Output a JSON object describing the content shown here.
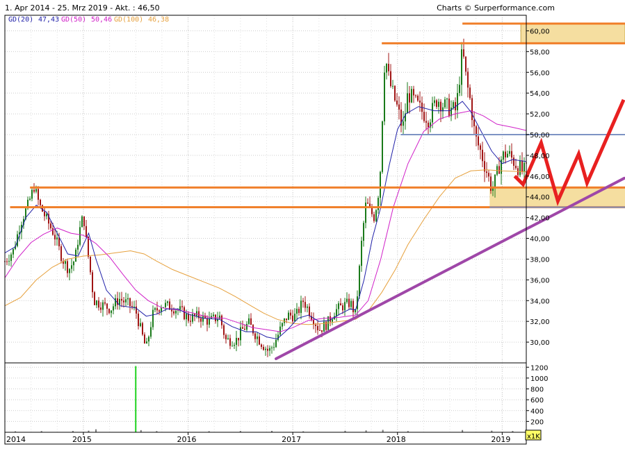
{
  "header": {
    "range_text": "1. Apr 2014 - 25. Mrz 2019 - Akt. : 46,50",
    "credit_text": "Charts © Surperformance.com"
  },
  "chart_data": {
    "type": "candlestick",
    "legend": [
      {
        "text": "GD(20)",
        "value": "47,43",
        "color": "#1f1fa8"
      },
      {
        "text": "GD(50)",
        "value": "50,46",
        "color": "#d020c8"
      },
      {
        "text": "GD(100)",
        "value": "46,38",
        "color": "#e6a03c"
      }
    ],
    "y_axis": {
      "ylim": [
        28.0,
        61.5
      ],
      "ticks": [
        30,
        32,
        34,
        36,
        38,
        40,
        42,
        44,
        46,
        48,
        50,
        52,
        54,
        56,
        58,
        60
      ],
      "tick_labels": [
        "30,00",
        "32,00",
        "34,00",
        "36,00",
        "38,00",
        "40,00",
        "42,00",
        "44,00",
        "46,00",
        "48,00",
        "50,00",
        "52,00",
        "54,00",
        "56,00",
        "58,00",
        "60,00"
      ]
    },
    "volume_axis": {
      "ylim": [
        0,
        1280
      ],
      "ticks": [
        200,
        400,
        600,
        800,
        1000,
        1200
      ],
      "tick_labels": [
        "200",
        "400",
        "600",
        "800",
        "1000",
        "1200"
      ],
      "unit": "x1K"
    },
    "x_axis": {
      "range": [
        2014.25,
        2019.23
      ],
      "ticks": [
        2014,
        2015,
        2016,
        2017,
        2018,
        2019
      ],
      "tick_labels": [
        "2014",
        "2015",
        "2016",
        "2017",
        "2018",
        "2019"
      ]
    },
    "price_path": [
      [
        2014.25,
        37.8
      ],
      [
        2014.33,
        38.8
      ],
      [
        2014.4,
        41.5
      ],
      [
        2014.47,
        43.2
      ],
      [
        2014.53,
        45.0
      ],
      [
        2014.58,
        43.2
      ],
      [
        2014.66,
        41.6
      ],
      [
        2014.72,
        40.4
      ],
      [
        2014.8,
        38.0
      ],
      [
        2014.86,
        37.0
      ],
      [
        2014.92,
        38.0
      ],
      [
        2014.96,
        40.6
      ],
      [
        2015.0,
        42.3
      ],
      [
        2015.03,
        39.5
      ],
      [
        2015.07,
        36.5
      ],
      [
        2015.1,
        34.0
      ],
      [
        2015.18,
        33.6
      ],
      [
        2015.26,
        33.2
      ],
      [
        2015.34,
        34.2
      ],
      [
        2015.44,
        33.6
      ],
      [
        2015.5,
        33.0
      ],
      [
        2015.56,
        30.7
      ],
      [
        2015.6,
        29.3
      ],
      [
        2015.66,
        32.6
      ],
      [
        2015.74,
        33.6
      ],
      [
        2015.84,
        33.4
      ],
      [
        2015.93,
        33.0
      ],
      [
        2016.0,
        32.3
      ],
      [
        2016.1,
        32.5
      ],
      [
        2016.2,
        32.0
      ],
      [
        2016.3,
        32.5
      ],
      [
        2016.36,
        30.2
      ],
      [
        2016.46,
        30.2
      ],
      [
        2016.52,
        31.2
      ],
      [
        2016.58,
        31.8
      ],
      [
        2016.64,
        30.8
      ],
      [
        2016.71,
        29.8
      ],
      [
        2016.77,
        29.1
      ],
      [
        2016.82,
        29.8
      ],
      [
        2016.88,
        31.2
      ],
      [
        2016.95,
        32.6
      ],
      [
        2017.03,
        32.5
      ],
      [
        2017.1,
        34.0
      ],
      [
        2017.18,
        32.6
      ],
      [
        2017.25,
        31.2
      ],
      [
        2017.33,
        31.8
      ],
      [
        2017.4,
        33.0
      ],
      [
        2017.48,
        33.5
      ],
      [
        2017.55,
        33.8
      ],
      [
        2017.6,
        32.6
      ],
      [
        2017.64,
        37.5
      ],
      [
        2017.66,
        40.0
      ],
      [
        2017.7,
        43.5
      ],
      [
        2017.74,
        42.6
      ],
      [
        2017.78,
        42.0
      ],
      [
        2017.83,
        45.2
      ],
      [
        2017.85,
        50.5
      ],
      [
        2017.88,
        57.8
      ],
      [
        2017.92,
        55.2
      ],
      [
        2017.96,
        53.8
      ],
      [
        2018.0,
        52.5
      ],
      [
        2018.05,
        50.5
      ],
      [
        2018.1,
        54.0
      ],
      [
        2018.16,
        53.2
      ],
      [
        2018.22,
        52.4
      ],
      [
        2018.3,
        51.5
      ],
      [
        2018.38,
        53.5
      ],
      [
        2018.44,
        52.8
      ],
      [
        2018.5,
        52.5
      ],
      [
        2018.56,
        52.3
      ],
      [
        2018.62,
        58.2
      ],
      [
        2018.66,
        55.0
      ],
      [
        2018.7,
        53.0
      ],
      [
        2018.74,
        49.8
      ],
      [
        2018.8,
        48.2
      ],
      [
        2018.86,
        46.2
      ],
      [
        2018.9,
        44.6
      ],
      [
        2018.94,
        45.6
      ],
      [
        2018.98,
        47.5
      ],
      [
        2019.04,
        48.3
      ],
      [
        2019.1,
        47.6
      ],
      [
        2019.16,
        46.8
      ],
      [
        2019.2,
        46.4
      ],
      [
        2019.23,
        46.5
      ]
    ],
    "ma20_path": [
      [
        2014.25,
        38.6
      ],
      [
        2014.35,
        39.2
      ],
      [
        2014.45,
        42.0
      ],
      [
        2014.55,
        43.2
      ],
      [
        2014.65,
        42.5
      ],
      [
        2014.75,
        40.5
      ],
      [
        2014.85,
        38.5
      ],
      [
        2014.95,
        38.3
      ],
      [
        2015.05,
        40.5
      ],
      [
        2015.12,
        38.0
      ],
      [
        2015.22,
        35.0
      ],
      [
        2015.35,
        33.5
      ],
      [
        2015.5,
        33.3
      ],
      [
        2015.6,
        32.5
      ],
      [
        2015.7,
        32.7
      ],
      [
        2015.8,
        33.2
      ],
      [
        2015.9,
        33.2
      ],
      [
        2016.0,
        32.7
      ],
      [
        2016.15,
        32.3
      ],
      [
        2016.3,
        32.2
      ],
      [
        2016.42,
        31.5
      ],
      [
        2016.55,
        31.0
      ],
      [
        2016.65,
        31.0
      ],
      [
        2016.75,
        30.5
      ],
      [
        2016.85,
        30.3
      ],
      [
        2016.95,
        31.2
      ],
      [
        2017.05,
        32.3
      ],
      [
        2017.15,
        32.6
      ],
      [
        2017.25,
        32.0
      ],
      [
        2017.35,
        32.1
      ],
      [
        2017.45,
        32.7
      ],
      [
        2017.55,
        33.2
      ],
      [
        2017.6,
        33.1
      ],
      [
        2017.68,
        36.0
      ],
      [
        2017.76,
        40.0
      ],
      [
        2017.84,
        43.0
      ],
      [
        2017.92,
        47.0
      ],
      [
        2018.0,
        50.5
      ],
      [
        2018.08,
        52.0
      ],
      [
        2018.2,
        52.7
      ],
      [
        2018.35,
        52.3
      ],
      [
        2018.5,
        52.3
      ],
      [
        2018.62,
        53.2
      ],
      [
        2018.7,
        52.2
      ],
      [
        2018.8,
        50.3
      ],
      [
        2018.9,
        48.4
      ],
      [
        2019.0,
        47.2
      ],
      [
        2019.1,
        47.6
      ],
      [
        2019.23,
        47.4
      ]
    ],
    "ma50_path": [
      [
        2014.25,
        36.2
      ],
      [
        2014.38,
        38.2
      ],
      [
        2014.5,
        39.6
      ],
      [
        2014.62,
        40.4
      ],
      [
        2014.75,
        41.0
      ],
      [
        2014.88,
        40.5
      ],
      [
        2015.0,
        40.3
      ],
      [
        2015.12,
        39.5
      ],
      [
        2015.25,
        38.2
      ],
      [
        2015.38,
        36.5
      ],
      [
        2015.5,
        35.0
      ],
      [
        2015.62,
        34.0
      ],
      [
        2015.75,
        33.3
      ],
      [
        2015.9,
        33.1
      ],
      [
        2016.05,
        32.8
      ],
      [
        2016.2,
        32.4
      ],
      [
        2016.35,
        32.3
      ],
      [
        2016.5,
        31.8
      ],
      [
        2016.62,
        31.4
      ],
      [
        2016.75,
        31.2
      ],
      [
        2016.88,
        31.0
      ],
      [
        2017.0,
        31.4
      ],
      [
        2017.15,
        32.1
      ],
      [
        2017.3,
        32.3
      ],
      [
        2017.45,
        32.4
      ],
      [
        2017.6,
        32.6
      ],
      [
        2017.72,
        34.0
      ],
      [
        2017.84,
        38.0
      ],
      [
        2017.96,
        43.0
      ],
      [
        2018.1,
        47.2
      ],
      [
        2018.25,
        50.3
      ],
      [
        2018.4,
        51.5
      ],
      [
        2018.55,
        52.0
      ],
      [
        2018.7,
        52.3
      ],
      [
        2018.82,
        51.8
      ],
      [
        2018.95,
        51.0
      ],
      [
        2019.1,
        50.7
      ],
      [
        2019.23,
        50.4
      ]
    ],
    "ma100_path": [
      [
        2014.25,
        33.5
      ],
      [
        2014.4,
        34.3
      ],
      [
        2014.55,
        36.0
      ],
      [
        2014.7,
        37.2
      ],
      [
        2014.85,
        38.0
      ],
      [
        2015.0,
        38.3
      ],
      [
        2015.15,
        38.4
      ],
      [
        2015.3,
        38.6
      ],
      [
        2015.45,
        38.8
      ],
      [
        2015.58,
        38.5
      ],
      [
        2015.7,
        37.8
      ],
      [
        2015.85,
        37.0
      ],
      [
        2016.0,
        36.4
      ],
      [
        2016.15,
        35.8
      ],
      [
        2016.3,
        35.2
      ],
      [
        2016.45,
        34.4
      ],
      [
        2016.6,
        33.5
      ],
      [
        2016.72,
        32.8
      ],
      [
        2016.85,
        32.2
      ],
      [
        2017.0,
        31.8
      ],
      [
        2017.15,
        31.7
      ],
      [
        2017.3,
        31.8
      ],
      [
        2017.45,
        32.0
      ],
      [
        2017.6,
        32.2
      ],
      [
        2017.72,
        33.0
      ],
      [
        2017.85,
        34.8
      ],
      [
        2017.98,
        37.0
      ],
      [
        2018.1,
        39.4
      ],
      [
        2018.25,
        41.8
      ],
      [
        2018.4,
        44.0
      ],
      [
        2018.55,
        45.8
      ],
      [
        2018.7,
        46.5
      ],
      [
        2018.85,
        46.6
      ],
      [
        2019.0,
        46.5
      ],
      [
        2019.23,
        46.4
      ]
    ],
    "volume_bars": [
      [
        2014.35,
        18
      ],
      [
        2014.6,
        22
      ],
      [
        2014.9,
        25
      ],
      [
        2015.05,
        30
      ],
      [
        2015.12,
        55
      ],
      [
        2015.5,
        1220
      ],
      [
        2015.55,
        40
      ],
      [
        2015.7,
        22
      ],
      [
        2016.2,
        20
      ],
      [
        2016.5,
        24
      ],
      [
        2016.8,
        26
      ],
      [
        2017.1,
        18
      ],
      [
        2017.5,
        28
      ],
      [
        2017.7,
        35
      ],
      [
        2017.86,
        45
      ],
      [
        2018.1,
        22
      ],
      [
        2018.62,
        42
      ],
      [
        2018.9,
        30
      ],
      [
        2019.1,
        24
      ]
    ],
    "annotations": {
      "orange_lines": [
        {
          "x_start": 2018.62,
          "x_end": 2019.23,
          "y": 60.7,
          "extends_past_axis": true
        },
        {
          "x_start": 2017.85,
          "x_end": 2019.23,
          "y": 58.8,
          "extends_past_axis": true
        },
        {
          "x_start": 2014.49,
          "x_end": 2019.23,
          "y": 44.9,
          "extends_past_axis": true
        },
        {
          "x_start": 2014.3,
          "x_end": 2019.23,
          "y": 43.0,
          "extends_past_axis": true
        }
      ],
      "blue_lines": [
        {
          "x_start": 2018.03,
          "x_end": 2019.23,
          "y": 50.0,
          "extends_past_axis": true
        },
        {
          "x_start": 2018.88,
          "x_end": 2019.23,
          "y": 43.0,
          "extends_past_axis": true
        }
      ],
      "support_trendline": {
        "from": [
          2016.84,
          28.4
        ],
        "to_page_edge_price": 45.8
      },
      "projected_path": {
        "from": [
          2019.12,
          46.0
        ],
        "description": "zig-zag projection past the axis"
      }
    },
    "colors": {
      "candle_up": "#1a7a1a",
      "candle_down": "#a01414",
      "grid": "#cccccc",
      "orange_line": "#f07e28",
      "blue_line": "#7d93c4",
      "trendline": "#9f47a8",
      "projection": "#e82020",
      "band_fill": "#f5dea0",
      "volume_bar": "#1ed21e"
    }
  }
}
